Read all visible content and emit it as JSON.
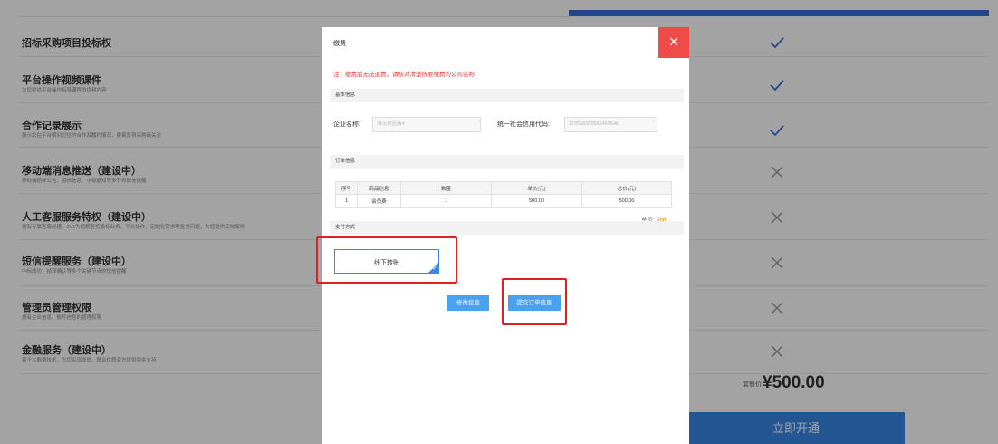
{
  "features": [
    {
      "title": "招标采购项目投标权",
      "desc": "",
      "status": "check"
    },
    {
      "title": "平台操作视频课件",
      "desc": "为您提供平台操作指导课程的视频内容",
      "status": "check"
    },
    {
      "title": "合作记录展示",
      "desc": "展示您在平台期间过往的合作及履约情况，更易获得采购商关注",
      "status": "check"
    },
    {
      "title": "移动端消息推送（建设中）",
      "desc": "移动端招标公告、招标信息、中标通知等多节点微信提醒",
      "status": "cross"
    },
    {
      "title": "人工客服服务特权（建设中）",
      "desc": "拥有专属客服经理、1V1为您解答招投标业务、平台操作、定制化需求等各类问题，为您提供高效服务",
      "status": "cross"
    },
    {
      "title": "短信提醒服务（建设中）",
      "desc": "中标成功、结算确认等多个关键节点的短信提醒",
      "status": "cross"
    },
    {
      "title": "管理员管理权限",
      "desc": "拥有企业信息、账号信息的管理权限",
      "status": "cross"
    },
    {
      "title": "金融服务（建设中）",
      "desc": "基于大数据技术，为您实现增值、联合优质资方提供资金支持",
      "status": "cross"
    }
  ],
  "price": {
    "label": "套餐价",
    "amount": "¥500.00"
  },
  "open_button": "立即开通",
  "modal": {
    "title": "缴费",
    "close": "×",
    "notice": "注：缴费后无法退费，请核对清楚所要缴费的公司名称",
    "basic_section": "基本信息",
    "company_label": "企业名称:",
    "company_value": "演示供应商4",
    "credit_label": "统一社会信用代码:",
    "credit_value": "123568585565469546",
    "order_section": "订单信息",
    "table_headers": [
      "序号",
      "商品信息",
      "数量",
      "单价(元)",
      "总价(元)"
    ],
    "table_rows": [
      [
        "1",
        "会员费",
        "1",
        "500.00",
        "500.00"
      ]
    ],
    "total_label": "总价:",
    "total_value": "500",
    "pay_section": "支付方式",
    "pay_option": "线下转账",
    "edit_button": "修改信息",
    "submit_button": "提交订单信息"
  },
  "colors": {
    "accent": "#3a87e8",
    "close": "#ee4b4b",
    "notice": "#e53935",
    "highlight": "#e02020"
  }
}
